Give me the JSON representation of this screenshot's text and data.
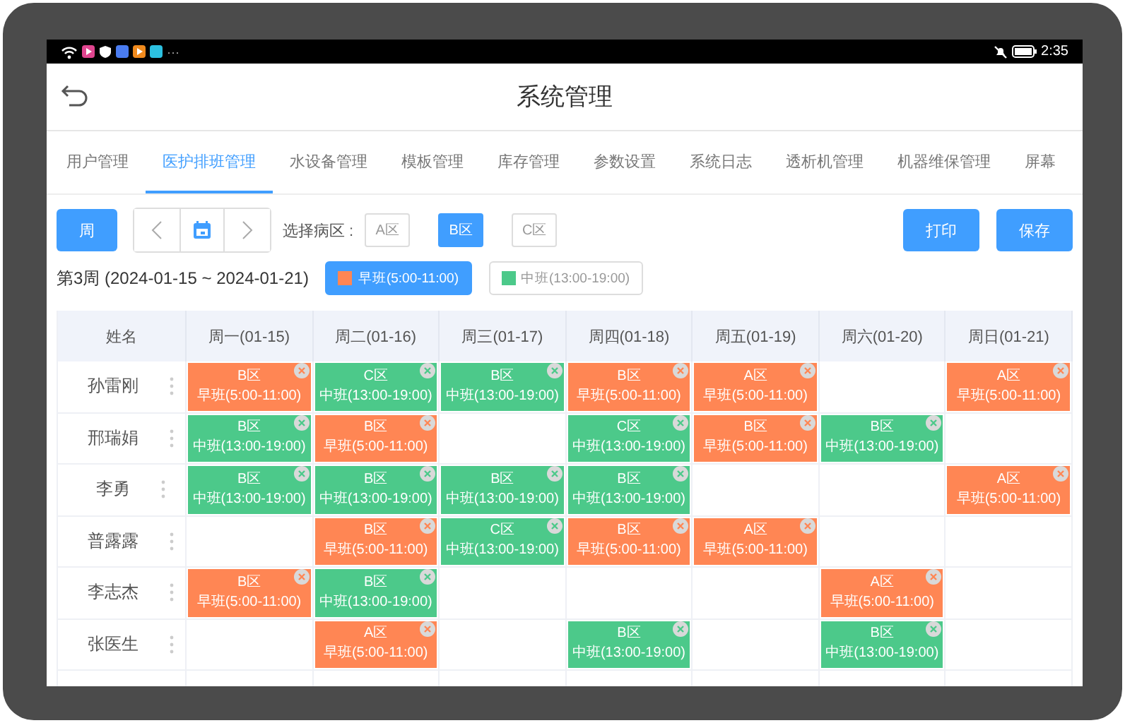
{
  "status_bar": {
    "time": "2:35",
    "more": "···"
  },
  "header": {
    "title": "系统管理"
  },
  "tabs": [
    {
      "label": "用户管理",
      "selected": false
    },
    {
      "label": "医护排班管理",
      "selected": true
    },
    {
      "label": "水设备管理",
      "selected": false
    },
    {
      "label": "模板管理",
      "selected": false
    },
    {
      "label": "库存管理",
      "selected": false
    },
    {
      "label": "参数设置",
      "selected": false
    },
    {
      "label": "系统日志",
      "selected": false
    },
    {
      "label": "透析机管理",
      "selected": false
    },
    {
      "label": "机器维保管理",
      "selected": false
    },
    {
      "label": "屏幕",
      "selected": false
    }
  ],
  "toolbar": {
    "view_button": "周",
    "zone_label": "选择病区 :",
    "zones": [
      {
        "label": "A区",
        "selected": false
      },
      {
        "label": "B区",
        "selected": true
      },
      {
        "label": "C区",
        "selected": false
      }
    ],
    "buttons": [
      "打印",
      "保存"
    ]
  },
  "week": {
    "label": "第3周 (2024-01-15 ~ 2024-01-21)",
    "legend": [
      {
        "label": "早班(5:00-11:00)",
        "color": "#ff8654",
        "selected": true
      },
      {
        "label": "中班(13:00-19:00)",
        "color": "#4cc98a",
        "selected": false
      }
    ]
  },
  "table": {
    "columns": [
      "姓名",
      "周一(01-15)",
      "周二(01-16)",
      "周三(01-17)",
      "周四(01-18)",
      "周五(01-19)",
      "周六(01-20)",
      "周日(01-21)"
    ],
    "rows": [
      {
        "cells": [
          {
            "kind": "name",
            "name": "孙雷刚"
          },
          {
            "kind": "early",
            "zone": "B区",
            "shift": "早班(5:00-11:00)"
          },
          {
            "kind": "middle",
            "zone": "C区",
            "shift": "中班(13:00-19:00)"
          },
          {
            "kind": "middle",
            "zone": "B区",
            "shift": "中班(13:00-19:00)"
          },
          {
            "kind": "early",
            "zone": "B区",
            "shift": "早班(5:00-11:00)"
          },
          {
            "kind": "early",
            "zone": "A区",
            "shift": "早班(5:00-11:00)"
          },
          null,
          {
            "kind": "early",
            "zone": "A区",
            "shift": "早班(5:00-11:00)"
          }
        ]
      },
      {
        "cells": [
          {
            "kind": "name",
            "name": "邢瑞娟"
          },
          {
            "kind": "middle",
            "zone": "B区",
            "shift": "中班(13:00-19:00)"
          },
          {
            "kind": "early",
            "zone": "B区",
            "shift": "早班(5:00-11:00)"
          },
          null,
          {
            "kind": "middle",
            "zone": "C区",
            "shift": "中班(13:00-19:00)"
          },
          {
            "kind": "early",
            "zone": "B区",
            "shift": "早班(5:00-11:00)"
          },
          {
            "kind": "middle",
            "zone": "B区",
            "shift": "中班(13:00-19:00)"
          },
          null
        ]
      },
      {
        "cells": [
          {
            "kind": "name",
            "name": "李勇"
          },
          {
            "kind": "middle",
            "zone": "B区",
            "shift": "中班(13:00-19:00)"
          },
          {
            "kind": "middle",
            "zone": "B区",
            "shift": "中班(13:00-19:00)"
          },
          {
            "kind": "middle",
            "zone": "B区",
            "shift": "中班(13:00-19:00)"
          },
          {
            "kind": "middle",
            "zone": "B区",
            "shift": "中班(13:00-19:00)"
          },
          null,
          null,
          {
            "kind": "early",
            "zone": "A区",
            "shift": "早班(5:00-11:00)"
          }
        ]
      },
      {
        "cells": [
          {
            "kind": "name",
            "name": "普露露"
          },
          null,
          {
            "kind": "early",
            "zone": "B区",
            "shift": "早班(5:00-11:00)"
          },
          {
            "kind": "middle",
            "zone": "C区",
            "shift": "中班(13:00-19:00)"
          },
          {
            "kind": "early",
            "zone": "B区",
            "shift": "早班(5:00-11:00)"
          },
          {
            "kind": "early",
            "zone": "A区",
            "shift": "早班(5:00-11:00)"
          },
          null,
          null
        ]
      },
      {
        "cells": [
          {
            "kind": "name",
            "name": "李志杰"
          },
          {
            "kind": "early",
            "zone": "B区",
            "shift": "早班(5:00-11:00)"
          },
          {
            "kind": "middle",
            "zone": "B区",
            "shift": "中班(13:00-19:00)"
          },
          null,
          null,
          null,
          {
            "kind": "early",
            "zone": "A区",
            "shift": "早班(5:00-11:00)"
          },
          null
        ]
      },
      {
        "cells": [
          {
            "kind": "name",
            "name": "张医生"
          },
          null,
          {
            "kind": "early",
            "zone": "A区",
            "shift": "早班(5:00-11:00)"
          },
          null,
          {
            "kind": "middle",
            "zone": "B区",
            "shift": "中班(13:00-19:00)"
          },
          null,
          {
            "kind": "middle",
            "zone": "B区",
            "shift": "中班(13:00-19:00)"
          },
          null
        ]
      }
    ]
  }
}
